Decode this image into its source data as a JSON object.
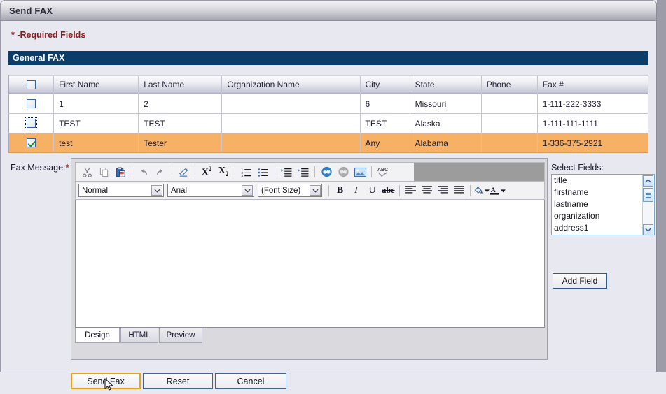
{
  "window": {
    "title": "Send FAX"
  },
  "form": {
    "required_note": "* -Required Fields",
    "section_title": "General FAX",
    "fax_message_label": "Fax Message:",
    "required_star": "*"
  },
  "grid": {
    "columns": [
      "",
      "First Name",
      "Last Name",
      "Organization Name",
      "City",
      "State",
      "Phone",
      "Fax #"
    ],
    "header_checkbox_checked": false,
    "rows": [
      {
        "checked": false,
        "focused": false,
        "first_name": "1",
        "last_name": "2",
        "organization": "",
        "city": "6",
        "state": "Missouri",
        "phone": "",
        "fax": "1-111-222-3333",
        "selected": false
      },
      {
        "checked": false,
        "focused": true,
        "first_name": "TEST",
        "last_name": "TEST",
        "organization": "",
        "city": "TEST",
        "state": "Alaska",
        "phone": "",
        "fax": "1-111-111-1111",
        "selected": false
      },
      {
        "checked": true,
        "focused": false,
        "first_name": "test",
        "last_name": "Tester",
        "organization": "",
        "city": "Any",
        "state": "Alabama",
        "phone": "",
        "fax": "1-336-375-2921",
        "selected": true
      }
    ]
  },
  "editor": {
    "toolbar_row1": [
      {
        "icon": "cut-icon",
        "name": "cut"
      },
      {
        "icon": "copy-icon",
        "name": "copy"
      },
      {
        "icon": "paste-icon",
        "name": "paste"
      },
      {
        "icon": "undo-icon",
        "name": "undo"
      },
      {
        "icon": "redo-icon",
        "name": "redo"
      },
      {
        "icon": "eraser-icon",
        "name": "remove-format"
      },
      {
        "icon": "superscript-icon",
        "name": "superscript",
        "label": "X",
        "script": "2",
        "script_pos": "sup"
      },
      {
        "icon": "subscript-icon",
        "name": "subscript",
        "label": "X",
        "script": "2",
        "script_pos": "sub"
      },
      {
        "icon": "ordered-list-icon",
        "name": "ordered-list"
      },
      {
        "icon": "unordered-list-icon",
        "name": "unordered-list"
      },
      {
        "icon": "indent-icon",
        "name": "indent"
      },
      {
        "icon": "outdent-icon",
        "name": "outdent"
      },
      {
        "icon": "link-icon",
        "name": "insert-link"
      },
      {
        "icon": "unlink-icon",
        "name": "remove-link"
      },
      {
        "icon": "image-icon",
        "name": "insert-image"
      },
      {
        "icon": "spellcheck-icon",
        "name": "spellcheck",
        "label": "ABC"
      }
    ],
    "style_select": {
      "value": "Normal"
    },
    "font_select": {
      "value": "Arial"
    },
    "size_select": {
      "value": "(Font Size)"
    },
    "format_buttons": [
      {
        "name": "bold",
        "label": "B",
        "icon": "bold-icon"
      },
      {
        "name": "italic",
        "label": "I",
        "icon": "italic-icon"
      },
      {
        "name": "underline",
        "label": "U",
        "icon": "underline-icon"
      },
      {
        "name": "strikethrough",
        "label": "abc",
        "icon": "strikethrough-icon"
      }
    ],
    "align_buttons": [
      {
        "name": "align-left",
        "icon": "align-left-icon"
      },
      {
        "name": "align-center",
        "icon": "align-center-icon"
      },
      {
        "name": "align-right",
        "icon": "align-right-icon"
      },
      {
        "name": "align-justify",
        "icon": "align-justify-icon"
      }
    ],
    "color_buttons": [
      {
        "name": "background-color",
        "icon": "paint-bucket-icon"
      },
      {
        "name": "font-color",
        "icon": "font-color-icon"
      }
    ],
    "content": "",
    "tabs": [
      {
        "label": "Design",
        "active": true
      },
      {
        "label": "HTML",
        "active": false
      },
      {
        "label": "Preview",
        "active": false
      }
    ]
  },
  "select_fields": {
    "label": "Select Fields:",
    "options": [
      "title",
      "firstname",
      "lastname",
      "organization",
      "address1"
    ],
    "add_button": "Add Field"
  },
  "actions": {
    "send": "Send Fax",
    "reset": "Reset",
    "cancel": "Cancel"
  },
  "colors": {
    "section_bar": "#0b3d6b",
    "selected_row": "#f7b165",
    "required_text": "#8b1a1a",
    "focus_border": "#e8a317"
  }
}
